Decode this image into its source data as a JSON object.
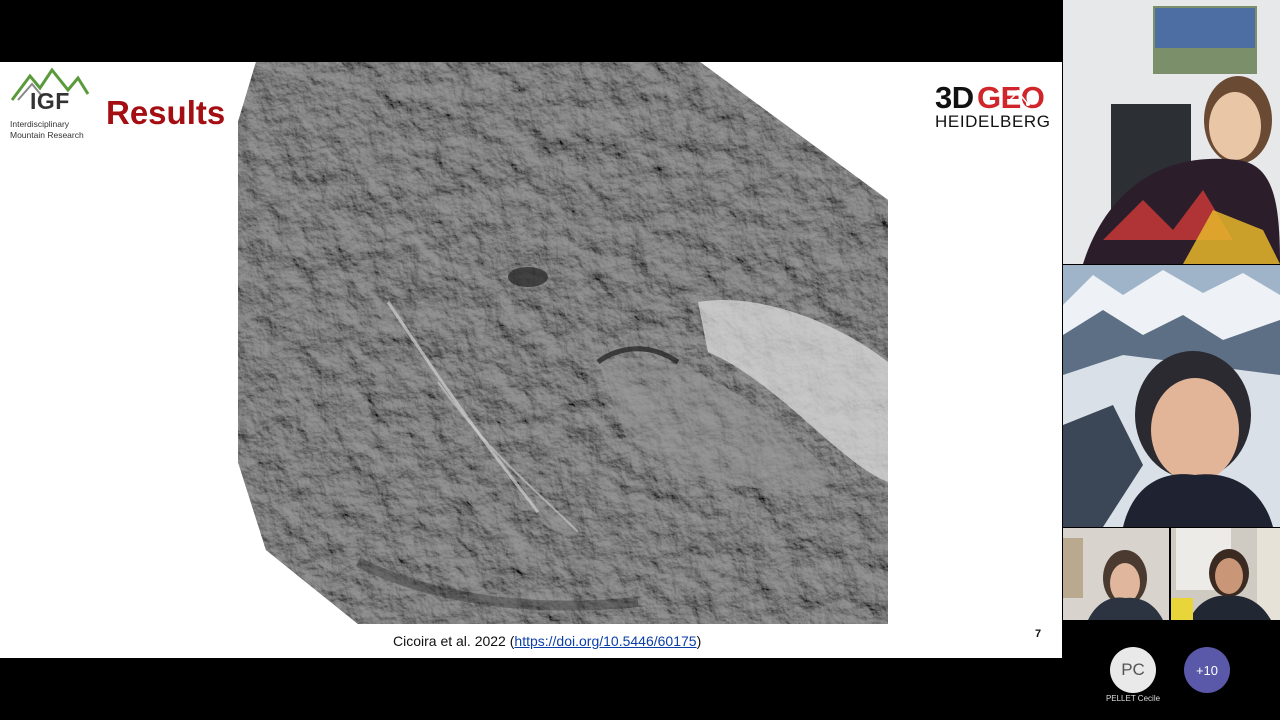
{
  "slide": {
    "logo_left": {
      "abbr": "IGF",
      "line1": "Interdisciplinary",
      "line2": "Mountain Research"
    },
    "title": "Results",
    "logo_right": {
      "part1": "3D",
      "part2": "GEO",
      "part3": "HEIDELBERG"
    },
    "citation_prefix": "Cicoira et al. 2022 (",
    "citation_link": "https://doi.org/10.5446/60175",
    "citation_suffix": ")",
    "slide_number": "7"
  },
  "participants": {
    "chip_initials": "PC",
    "chip_name": "PELLET Cecile",
    "more_count": "+10"
  },
  "colors": {
    "title_red": "#a40e12",
    "logo_red": "#d0262b",
    "more_chip": "#5a58a8",
    "background": "#000000"
  }
}
